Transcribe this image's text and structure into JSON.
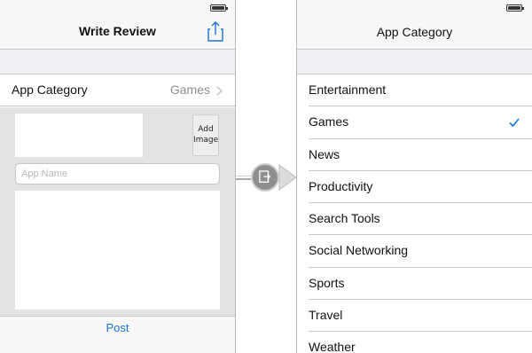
{
  "left_screen": {
    "nav_title": "Write Review",
    "share_icon": "share-icon",
    "category_row": {
      "label": "App Category",
      "value": "Games"
    },
    "add_image_label_line1": "Add",
    "add_image_label_line2": "Image",
    "app_name_placeholder": "App Name",
    "post_label": "Post"
  },
  "right_screen": {
    "nav_title": "App Category",
    "items": [
      {
        "label": "Entertainment",
        "selected": false
      },
      {
        "label": "Games",
        "selected": true
      },
      {
        "label": "News",
        "selected": false
      },
      {
        "label": "Productivity",
        "selected": false
      },
      {
        "label": "Search Tools",
        "selected": false
      },
      {
        "label": "Social Networking",
        "selected": false
      },
      {
        "label": "Sports",
        "selected": false
      },
      {
        "label": "Travel",
        "selected": false
      },
      {
        "label": "Weather",
        "selected": false
      }
    ]
  },
  "segue": {
    "icon": "segue-icon"
  },
  "colors": {
    "tint": "#1a73d9",
    "nav_bar": "#f7f7f7",
    "form_background": "#e3e3e3",
    "separator": "#c8c7cc"
  }
}
